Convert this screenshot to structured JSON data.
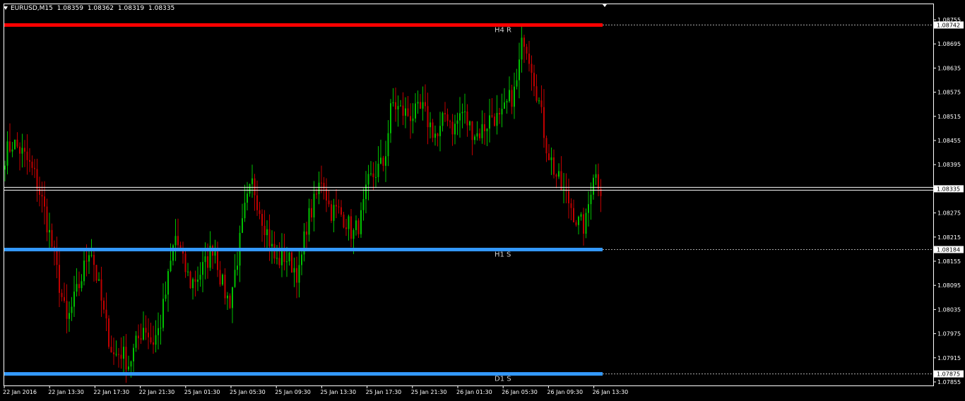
{
  "header": {
    "symbol": "EURUSD,M15",
    "open": "1.08359",
    "high": "1.08362",
    "low": "1.08319",
    "close": "1.08335"
  },
  "colors": {
    "background": "#000000",
    "bull": "#00c000",
    "bear": "#c00000",
    "resistance": "#ff0000",
    "support": "#3399ff",
    "price_line": "#ffffff",
    "axis": "#ffffff"
  },
  "chart_data": {
    "type": "candlestick",
    "ylim": [
      1.07855,
      1.08755
    ],
    "y_ticks": [
      "1.08755",
      "1.08695",
      "1.08635",
      "1.08575",
      "1.08515",
      "1.08455",
      "1.08395",
      "1.08275",
      "1.08215",
      "1.08155",
      "1.08095",
      "1.08035",
      "1.07975",
      "1.07915",
      "1.07855"
    ],
    "x_ticks": [
      "22 Jan 2016",
      "22 Jan 13:30",
      "22 Jan 17:30",
      "22 Jan 21:30",
      "25 Jan 01:30",
      "25 Jan 05:30",
      "25 Jan 09:30",
      "25 Jan 13:30",
      "25 Jan 17:30",
      "25 Jan 21:30",
      "26 Jan 01:30",
      "26 Jan 05:30",
      "26 Jan 09:30",
      "26 Jan 13:30"
    ],
    "levels": [
      {
        "label": "H4 R",
        "price": 1.08742,
        "price_label": "1.08742",
        "color": "#ff0000"
      },
      {
        "label": "H1 S",
        "price": 1.08184,
        "price_label": "1.08184",
        "color": "#3399ff"
      },
      {
        "label": "D1 S",
        "price": 1.07875,
        "price_label": "1.07875",
        "color": "#3399ff"
      }
    ],
    "current_price": 1.08335,
    "current_price_label": "1.08335",
    "price_anchors": [
      1.0842,
      1.0845,
      1.0843,
      1.084,
      1.0836,
      1.0829,
      1.082,
      1.081,
      1.08,
      1.0806,
      1.0812,
      1.082,
      1.081,
      1.08,
      1.0792,
      1.0793,
      1.079,
      1.0795,
      1.08,
      1.0795,
      1.0799,
      1.081,
      1.0822,
      1.0815,
      1.081,
      1.0812,
      1.0815,
      1.082,
      1.081,
      1.0805,
      1.0816,
      1.0828,
      1.0835,
      1.0828,
      1.0822,
      1.0815,
      1.0817,
      1.0815,
      1.0812,
      1.0825,
      1.083,
      1.0837,
      1.0828,
      1.0828,
      1.0826,
      1.0822,
      1.0826,
      1.0835,
      1.0838,
      1.084,
      1.0855,
      1.0853,
      1.0852,
      1.0852,
      1.0853,
      1.0849,
      1.0846,
      1.0853,
      1.0848,
      1.0853,
      1.0849,
      1.0847,
      1.0849,
      1.0852,
      1.085,
      1.0855,
      1.0858,
      1.0872,
      1.0865,
      1.0855,
      1.0844,
      1.0838,
      1.0833,
      1.083,
      1.0825,
      1.0824,
      1.0838,
      1.0834
    ]
  }
}
